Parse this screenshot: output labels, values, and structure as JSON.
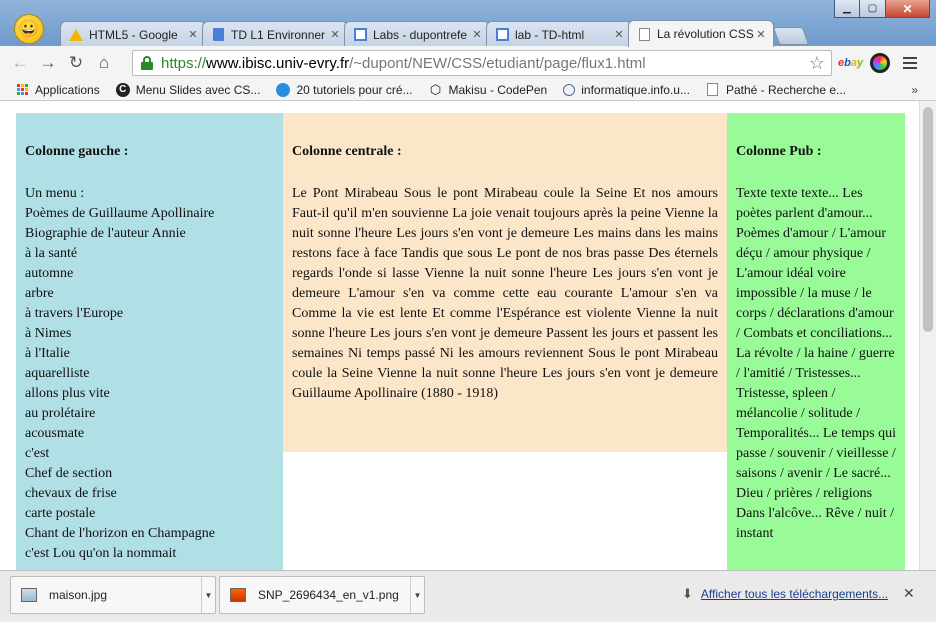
{
  "tabs": [
    {
      "title": "HTML5 - Google",
      "icon": "google-drive-icon",
      "active": false
    },
    {
      "title": "TD L1 Environner",
      "icon": "google-docs-icon",
      "active": false
    },
    {
      "title": "Labs - dupontrefe",
      "icon": "google-slides-icon",
      "active": false
    },
    {
      "title": "lab - TD-html",
      "icon": "google-slides-icon",
      "active": false
    },
    {
      "title": "La révolution CSS",
      "icon": "page-icon",
      "active": true
    }
  ],
  "omnibox": {
    "scheme": "https://",
    "host": "www.ibisc.univ-evry.fr",
    "path": "/~dupont/NEW/CSS/etudiant/page/flux1.html"
  },
  "bookmarks": [
    {
      "label": "Applications",
      "icon": "apps-grid-icon"
    },
    {
      "label": "Menu Slides avec CS...",
      "icon": "c-logo-icon"
    },
    {
      "label": "20 tutoriels pour cré...",
      "icon": "blue-dot-icon"
    },
    {
      "label": "Makisu - CodePen",
      "icon": "codepen-icon"
    },
    {
      "label": "informatique.info.u...",
      "icon": "globe-icon"
    },
    {
      "label": "Pathé - Recherche e...",
      "icon": "page-icon"
    }
  ],
  "bookmarks_more": "»",
  "page": {
    "left": {
      "title": "Colonne gauche :",
      "intro": "Un menu :",
      "items": [
        "Poèmes de Guillaume Apollinaire",
        "Biographie de l'auteur Annie",
        "à la santé",
        "automne",
        "arbre",
        "à travers l'Europe",
        "à Nimes",
        "à l'Italie",
        "aquarelliste",
        "allons plus vite",
        "au prolétaire",
        "acousmate",
        "c'est",
        "Chef de section",
        "chevaux de frise",
        "carte postale",
        "Chant de l'horizon en Champagne",
        "c'est Lou qu'on la nommait"
      ]
    },
    "center": {
      "title": "Colonne centrale :",
      "text": "Le Pont Mirabeau Sous le pont Mirabeau coule la Seine Et nos amours Faut-il qu'il m'en souvienne La joie venait toujours après la peine Vienne la nuit sonne l'heure Les jours s'en vont je demeure Les mains dans les mains restons face à face Tandis que sous Le pont de nos bras passe Des éternels regards l'onde si lasse Vienne la nuit sonne l'heure Les jours s'en vont je demeure L'amour s'en va comme cette eau courante L'amour s'en va Comme la vie est lente Et comme l'Espérance est violente Vienne la nuit sonne l'heure Les jours s'en vont je demeure Passent les jours et passent les semaines Ni temps passé Ni les amours reviennent Sous le pont Mirabeau coule la Seine Vienne la nuit sonne l'heure Les jours s'en vont je demeure Guillaume Apollinaire (1880 - 1918)"
    },
    "right": {
      "title": "Colonne Pub :",
      "text": "Texte texte texte... Les poètes parlent d'amour... Poèmes d'amour / L'amour déçu / amour physique / L'amour idéal voire impossible / la muse / le corps / déclarations d'amour / Combats et conciliations... La révolte / la haine / guerre / l'amitié / Tristesses... Tristesse, spleen / mélancolie / solitude / Temporalités... Le temps qui passe / souvenir / vieillesse / saisons / avenir / Le sacré... Dieu / prières / religions Dans l'alcôve... Rêve / nuit / instant"
    }
  },
  "downloads": {
    "items": [
      {
        "name": "maison.jpg",
        "icon": "image-file-icon"
      },
      {
        "name": "SNP_2696434_en_v1.png",
        "icon": "png-file-icon"
      }
    ],
    "show_all": "Afficher tous les téléchargements..."
  },
  "colors": {
    "left_bg": "#b0dfe5",
    "center_bg": "#fce6c9",
    "right_bg": "#98fb98"
  }
}
